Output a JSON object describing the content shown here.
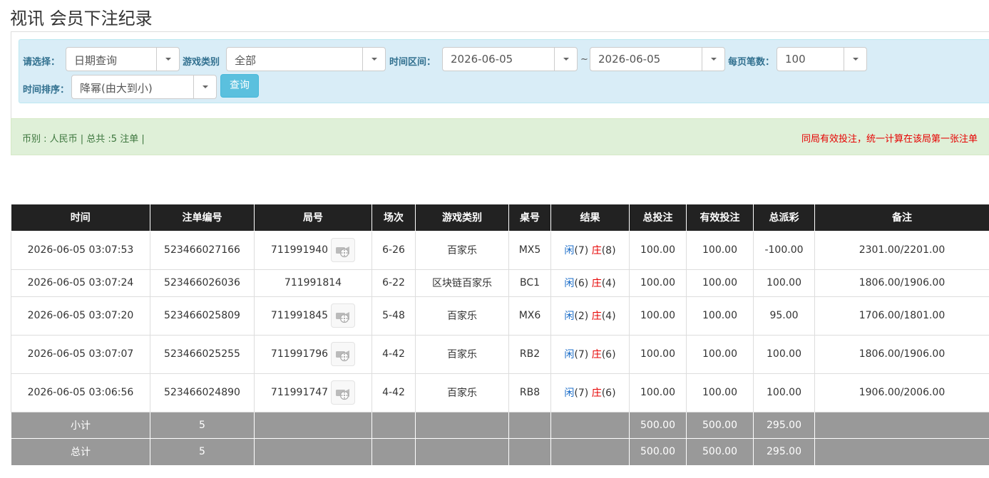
{
  "page": {
    "title": "视讯 会员下注纪录"
  },
  "filters": {
    "select_label": "请选择：",
    "select_value": "日期查询",
    "game_type_label": "游戏类别",
    "game_type_value": "全部",
    "time_range_label": "时间区间：",
    "start_date": "2026-06-05",
    "separator": "~",
    "end_date": "2026-06-05",
    "per_page_label": "每页笔数：",
    "per_page_value": "100",
    "sort_label": "时间排序：",
    "sort_value": "降幂(由大到小)",
    "query_button": "查询"
  },
  "summary": {
    "left": "币别 : 人民币 | 总共 :5 注单 |",
    "right": "同局有效投注，统一计算在该局第一张注单"
  },
  "table": {
    "headers": [
      "时间",
      "注单编号",
      "局号",
      "场次",
      "游戏类别",
      "桌号",
      "结果",
      "总投注",
      "有效投注",
      "总派彩",
      "备注"
    ],
    "rows": [
      {
        "time": "2026-06-05 03:07:53",
        "bet_id": "523466027166",
        "round": "711991940",
        "has_video": true,
        "shoe": "6-26",
        "game": "百家乐",
        "table": "MX5",
        "player": "闲",
        "player_pts": "(7)",
        "banker": "庄",
        "banker_pts": "(8)",
        "total_bet": "100.00",
        "valid_bet": "100.00",
        "payout": "-100.00",
        "payout_negative": true,
        "note": "2301.00/2201.00"
      },
      {
        "time": "2026-06-05 03:07:24",
        "bet_id": "523466026036",
        "round": "711991814",
        "has_video": false,
        "shoe": "6-22",
        "game": "区块链百家乐",
        "table": "BC1",
        "player": "闲",
        "player_pts": "(6)",
        "banker": "庄",
        "banker_pts": "(4)",
        "total_bet": "100.00",
        "valid_bet": "100.00",
        "payout": "100.00",
        "payout_negative": false,
        "note": "1806.00/1906.00"
      },
      {
        "time": "2026-06-05 03:07:20",
        "bet_id": "523466025809",
        "round": "711991845",
        "has_video": true,
        "shoe": "5-48",
        "game": "百家乐",
        "table": "MX6",
        "player": "闲",
        "player_pts": "(2)",
        "banker": "庄",
        "banker_pts": "(4)",
        "total_bet": "100.00",
        "valid_bet": "100.00",
        "payout": "95.00",
        "payout_negative": false,
        "note": "1706.00/1801.00"
      },
      {
        "time": "2026-06-05 03:07:07",
        "bet_id": "523466025255",
        "round": "711991796",
        "has_video": true,
        "shoe": "4-42",
        "game": "百家乐",
        "table": "RB2",
        "player": "闲",
        "player_pts": "(7)",
        "banker": "庄",
        "banker_pts": "(6)",
        "total_bet": "100.00",
        "valid_bet": "100.00",
        "payout": "100.00",
        "payout_negative": false,
        "note": "1806.00/1906.00"
      },
      {
        "time": "2026-06-05 03:06:56",
        "bet_id": "523466024890",
        "round": "711991747",
        "has_video": true,
        "shoe": "4-42",
        "game": "百家乐",
        "table": "RB8",
        "player": "闲",
        "player_pts": "(7)",
        "banker": "庄",
        "banker_pts": "(6)",
        "total_bet": "100.00",
        "valid_bet": "100.00",
        "payout": "100.00",
        "payout_negative": false,
        "note": "1906.00/2006.00"
      }
    ],
    "subtotal": {
      "label": "小计",
      "count": "5",
      "total_bet": "500.00",
      "valid_bet": "500.00",
      "payout": "295.00"
    },
    "total": {
      "label": "总计",
      "count": "5",
      "total_bet": "500.00",
      "valid_bet": "500.00",
      "payout": "295.00"
    }
  },
  "icons": {
    "video": "video-playback-icon",
    "dropdown": "chevron-down-icon"
  },
  "colors": {
    "table_header_bg": "#222222",
    "filter_bg": "#d9edf7",
    "summary_bg": "#dff0d8",
    "total_row_bg": "#999999",
    "player_blue": "#1a6cc8",
    "banker_red": "#e60000"
  }
}
